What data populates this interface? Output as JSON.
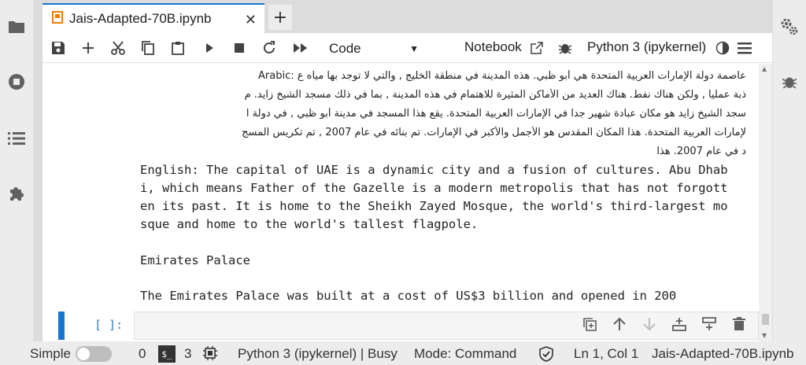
{
  "tab": {
    "title": "Jais-Adapted-70B.ipynb",
    "close": "✕",
    "new": "+"
  },
  "toolbar": {
    "cell_type": "Code",
    "notebook_label": "Notebook",
    "kernel_label": "Python 3 (ipykernel)"
  },
  "output": {
    "arabic_lines": [
      "عاصمة دولة الإمارات العربية المتحدة هي أبو ظبي. هذه المدينة في منطقة الخليج , والتي لا توجد بها مياه ع :Arabic",
      "ذبة عمليا , ولكن هناك نفط. هناك العديد من الأماكن المثيرة للاهتمام في هذه المدينة , بما في ذلك مسجد الشيخ زايد. م",
      "سجد الشيخ زايد هو مكان عبادة شهير جدا في الإمارات العربية المتحدة. يقع هذا المسجد في مدينة أبو ظبي , في دولة ا",
      "لإمارات العربية المتحدة. هذا المكان المقدس هو الأجمل والأكبر في الإمارات. تم بنائه في عام 2007 , تم تكريس المسج",
      "د في عام 2007. هذا"
    ],
    "english_lines": [
      "English: The capital of UAE is a dynamic city and a fusion of cultures. Abu Dhab",
      "i, which means Father of the Gazelle is a modern metropolis that has not forgott",
      "en its past. It is home to the Sheikh Zayed Mosque, the world's third-largest mo",
      "sque and home to the world's tallest flagpole."
    ],
    "heading": "Emirates Palace",
    "last_line": "The Emirates Palace was built at a cost of US$3 billion and opened in 200"
  },
  "input_cell": {
    "prompt": "[ ]:"
  },
  "status": {
    "mode_label": "Simple",
    "terminals": "0",
    "terminal_glyph": "$_",
    "kernels": "3",
    "kernel_status": "Python 3 (ipykernel) | Busy",
    "mode": "Mode: Command",
    "position": "Ln 1, Col 1",
    "filename": "Jais-Adapted-70B.ipynb"
  },
  "colors": {
    "accent": "#1976d2",
    "prompt": "#307fc1",
    "tab_icon": "#f57c00"
  }
}
